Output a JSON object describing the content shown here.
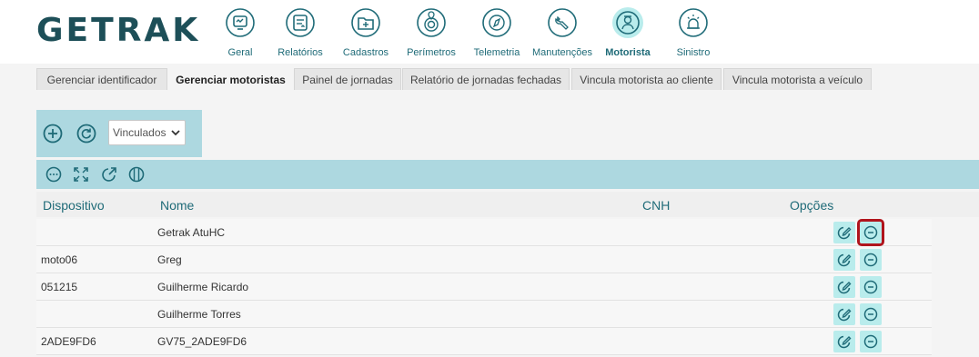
{
  "brand": {
    "logo_text": "GETRAK"
  },
  "nav": [
    {
      "label": "Geral",
      "icon": "monitor-chart-icon"
    },
    {
      "label": "Relatórios",
      "icon": "report-icon"
    },
    {
      "label": "Cadastros",
      "icon": "folder-plus-icon"
    },
    {
      "label": "Perímetros",
      "icon": "map-pin-target-icon"
    },
    {
      "label": "Telemetria",
      "icon": "compass-icon"
    },
    {
      "label": "Manutenções",
      "icon": "wrench-icon"
    },
    {
      "label": "Motorista",
      "icon": "driver-icon",
      "active": true
    },
    {
      "label": "Sinistro",
      "icon": "siren-icon"
    }
  ],
  "tabs": [
    {
      "label": "Gerenciar identificador"
    },
    {
      "label": "Gerenciar motoristas",
      "active": true
    },
    {
      "label": "Painel de jornadas"
    },
    {
      "label": "Relatório de jornadas fechadas"
    },
    {
      "label": "Vincula motorista ao cliente"
    },
    {
      "label": "Vincula motorista a veículo"
    }
  ],
  "toolbar": {
    "filter_value": "Vinculados"
  },
  "table": {
    "columns": [
      "Dispositivo",
      "Nome",
      "CNH",
      "Opções"
    ],
    "rows": [
      {
        "dispositivo": "",
        "nome": "Getrak AtuHC",
        "cnh": ""
      },
      {
        "dispositivo": "moto06",
        "nome": "Greg",
        "cnh": ""
      },
      {
        "dispositivo": "051215",
        "nome": "Guilherme Ricardo",
        "cnh": ""
      },
      {
        "dispositivo": "",
        "nome": "Guilherme Torres",
        "cnh": ""
      },
      {
        "dispositivo": "2ADE9FD6",
        "nome": "GV75_2ADE9FD6",
        "cnh": ""
      }
    ]
  },
  "colors": {
    "primary": "#1f6b78",
    "toolbar_bg": "#add8e0",
    "active_icon_bg": "#b9ecec",
    "highlight": "#b0141c"
  }
}
